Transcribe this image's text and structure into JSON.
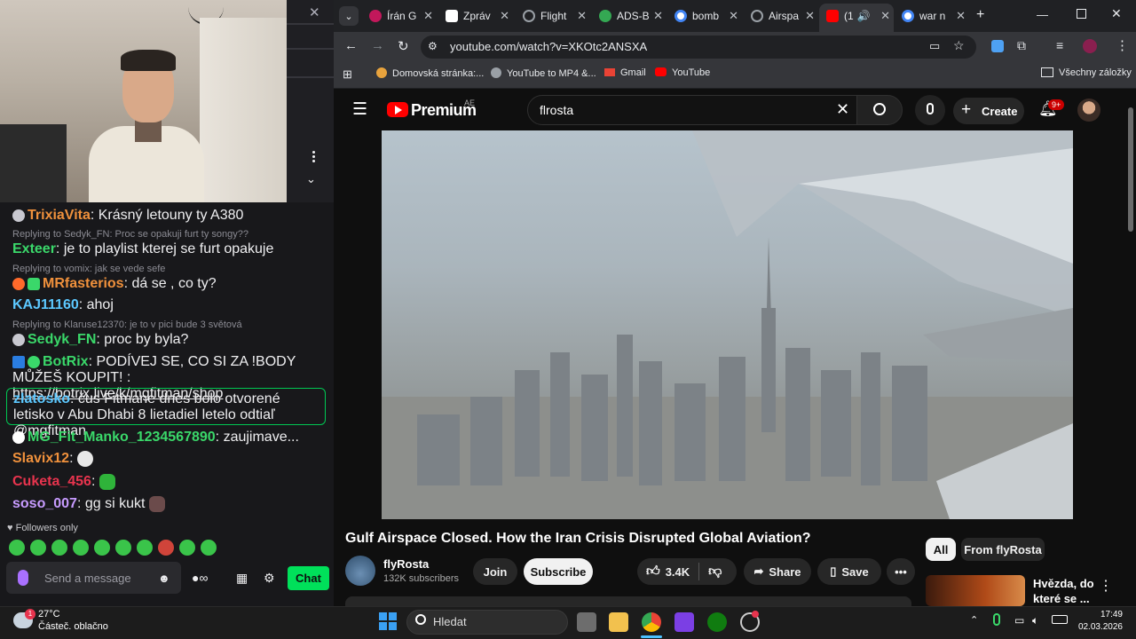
{
  "twitch": {
    "chat": [
      {
        "user": "TrixiaVita",
        "user_color": "#f0913c",
        "text": ": Krásný letouny ty A380"
      },
      {
        "reply_to": "Replying to Sedyk_FN: Proc se opakuji furt ty songy??",
        "user": "Exteer",
        "user_color": "#3ad86a",
        "text": ": je to playlist kterej se furt opakuje"
      },
      {
        "reply_to": "Replying to vomix: jak se vede sefe",
        "user": "MRfasterios",
        "user_color": "#f0913c",
        "text": ": dá se , co ty?"
      },
      {
        "user": "KAJ11160",
        "user_color": "#5cc8ff",
        "text": ": ahoj"
      },
      {
        "reply_to": "Replying to Klaruse12370: je to v pici bude 3 světová",
        "user": "Sedyk_FN",
        "user_color": "#3ad86a",
        "text": ": proc by byla?"
      },
      {
        "user": "BotRix",
        "user_color": "#3ad86a",
        "text": ": PODÍVEJ SE, CO SI ZA !BODY MŮŽEŠ KOUPIT! :",
        "link": "https://botrix.live/k/mgfitman/shop"
      },
      {
        "user": "zlatosko",
        "user_color": "#5cc8ff",
        "text": ": čus Fitmane dnes bolo otvorené letisko v Abu Dhabi 8 lietadiel letelo odtiaľ @mgfitman"
      },
      {
        "user": "MG_Fit_Manko_1234567890",
        "user_color": "#3ad86a",
        "text": ": zaujimave..."
      },
      {
        "user": "Slavix12",
        "user_color": "#f0913c",
        "text": ":"
      },
      {
        "user": "Cuketa_456",
        "user_color": "#e8344e",
        "text": ":"
      },
      {
        "user": "soso_007",
        "user_color": "#c79bff",
        "text": ": gg si kukt"
      }
    ],
    "followers_only": "Followers only",
    "send_placeholder": "Send a message",
    "chat_button": "Chat",
    "infinity": "∞"
  },
  "browser": {
    "tabs": [
      {
        "label": "Írán G",
        "color": "#c2185b"
      },
      {
        "label": "Zpráv",
        "color": "#ffffff"
      },
      {
        "label": "Flight",
        "color": "#9aa0a6"
      },
      {
        "label": "ADS-B",
        "color": "#34a853"
      },
      {
        "label": "bomb",
        "color": "#4285f4"
      },
      {
        "label": "Airspa",
        "color": "#9aa0a6"
      },
      {
        "label": "(1",
        "color": "#ff0000"
      },
      {
        "label": "war n",
        "color": "#4285f4"
      }
    ],
    "url": "youtube.com/watch?v=XKOtc2ANSXA",
    "bookmarks": [
      "Domovská stránka:...",
      "YouTube to MP4 &...",
      "Gmail",
      "YouTube"
    ],
    "all_bookmarks": "Všechny záložky"
  },
  "youtube": {
    "premium_label": "Premium",
    "region": "AE",
    "search_query": "flrosta",
    "create_label": "Create",
    "notifications": "9+",
    "video_title": "Gulf Airspace Closed. How the Iran Crisis Disrupted Global Aviation?",
    "channel_name": "flyRosta",
    "subscribers": "132K subscribers",
    "join_label": "Join",
    "subscribe_label": "Subscribe",
    "likes": "3.4K",
    "share_label": "Share",
    "save_label": "Save",
    "chips": [
      "All",
      "From flyRosta"
    ],
    "recommended_title": "Hvězda, do které se ..."
  },
  "taskbar": {
    "temperature": "27°C",
    "weather": "Částeč. oblačno",
    "weather_badge": "1",
    "search_label": "Hledat",
    "time": "17:49",
    "date": "02.03.2026"
  }
}
